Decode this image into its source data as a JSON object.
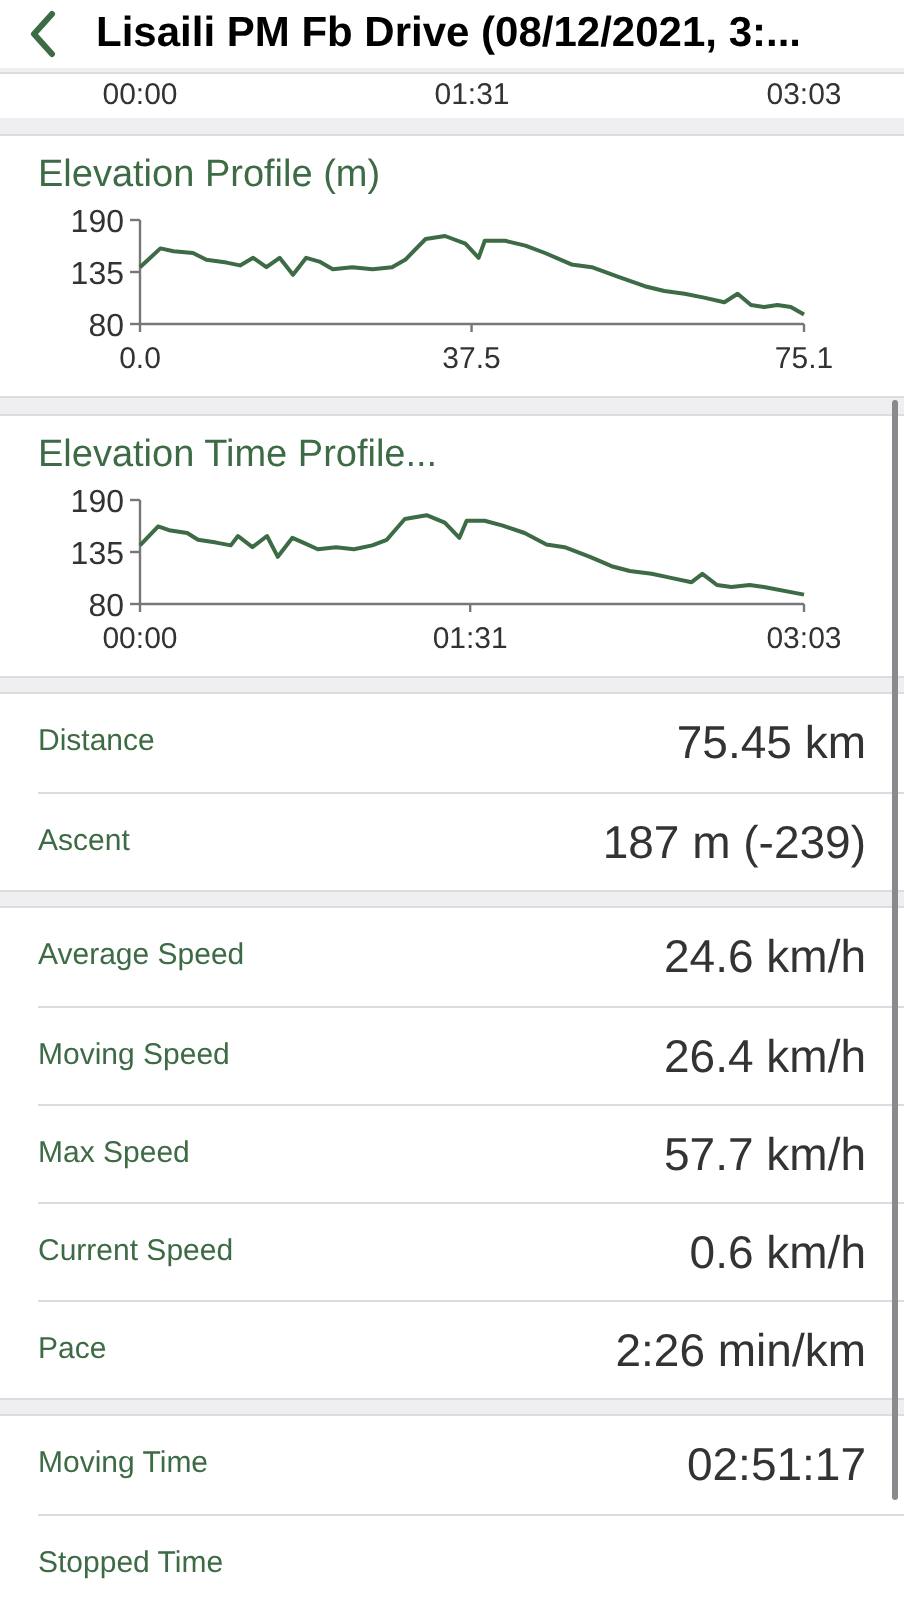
{
  "header": {
    "title": "Lisaili PM Fb Drive (08/12/2021, 3:..."
  },
  "top_axis_labels": [
    "00:00",
    "01:31",
    "03:03"
  ],
  "charts": [
    {
      "title": "Elevation Profile (m)",
      "chart_data": {
        "type": "line",
        "x": [
          0,
          2.3,
          3.8,
          6,
          7.5,
          9.8,
          11.3,
          12.8,
          14.3,
          15.8,
          17.3,
          18.8,
          20.3,
          21.8,
          24,
          26.3,
          28.5,
          30,
          32.3,
          34.5,
          36.8,
          38.3,
          39,
          41.3,
          43.6,
          45.8,
          48.8,
          51.1,
          54.1,
          57.1,
          59.3,
          61.6,
          63.8,
          66.1,
          67.6,
          69.1,
          70.6,
          72.1,
          73.6,
          75.1
        ],
        "series": [
          {
            "color": "#3d6b45",
            "values": [
              140,
              160,
              157,
              155,
              148,
              145,
              142,
              150,
              140,
              150,
              132,
              150,
              146,
              138,
              140,
              138,
              140,
              148,
              170,
              173,
              165,
              150,
              168,
              168,
              163,
              155,
              143,
              140,
              130,
              120,
              115,
              112,
              108,
              103,
              112,
              100,
              98,
              100,
              98,
              90
            ]
          }
        ],
        "xlim": [
          0,
          75.1
        ],
        "ylim": [
          80,
          190
        ],
        "xticks": [
          {
            "value": 0,
            "label": "0.0"
          },
          {
            "value": 37.5,
            "label": "37.5"
          },
          {
            "value": 75.1,
            "label": "75.1"
          }
        ],
        "yticks": [
          80,
          135,
          190
        ]
      }
    },
    {
      "title": "Elevation Time Profile...",
      "chart_data": {
        "type": "line",
        "x": [
          0,
          5,
          8,
          13,
          16,
          21,
          25,
          27,
          31,
          35,
          38,
          42,
          45,
          49,
          54,
          59,
          64,
          68,
          73,
          79,
          84,
          88,
          90,
          95,
          100,
          106,
          112,
          117,
          124,
          130,
          135,
          141,
          146,
          152,
          155,
          159,
          163,
          168,
          172,
          183
        ],
        "series": [
          {
            "color": "#3d6b45",
            "values": [
              142,
              162,
              158,
              155,
              148,
              145,
              142,
              152,
              140,
              152,
              130,
              150,
              145,
              138,
              140,
              138,
              142,
              148,
              170,
              174,
              166,
              150,
              168,
              168,
              163,
              155,
              143,
              140,
              130,
              120,
              115,
              112,
              108,
              103,
              112,
              100,
              98,
              100,
              98,
              90
            ]
          }
        ],
        "xlim": [
          0,
          183
        ],
        "ylim": [
          80,
          190
        ],
        "xticks": [
          {
            "value": 0,
            "label": "00:00"
          },
          {
            "value": 91,
            "label": "01:31"
          },
          {
            "value": 183,
            "label": "03:03"
          }
        ],
        "yticks": [
          80,
          135,
          190
        ]
      }
    }
  ],
  "stat_groups": [
    [
      {
        "label": "Distance",
        "value": "75.45 km"
      },
      {
        "label": "Ascent",
        "value": "187 m (-239)"
      }
    ],
    [
      {
        "label": "Average Speed",
        "value": "24.6 km/h"
      },
      {
        "label": "Moving Speed",
        "value": "26.4 km/h"
      },
      {
        "label": "Max Speed",
        "value": "57.7 km/h"
      },
      {
        "label": "Current Speed",
        "value": "0.6 km/h"
      },
      {
        "label": "Pace",
        "value": "2:26 min/km"
      }
    ],
    [
      {
        "label": "Moving Time",
        "value": "02:51:17"
      },
      {
        "label": "Stopped Time"
      }
    ]
  ]
}
